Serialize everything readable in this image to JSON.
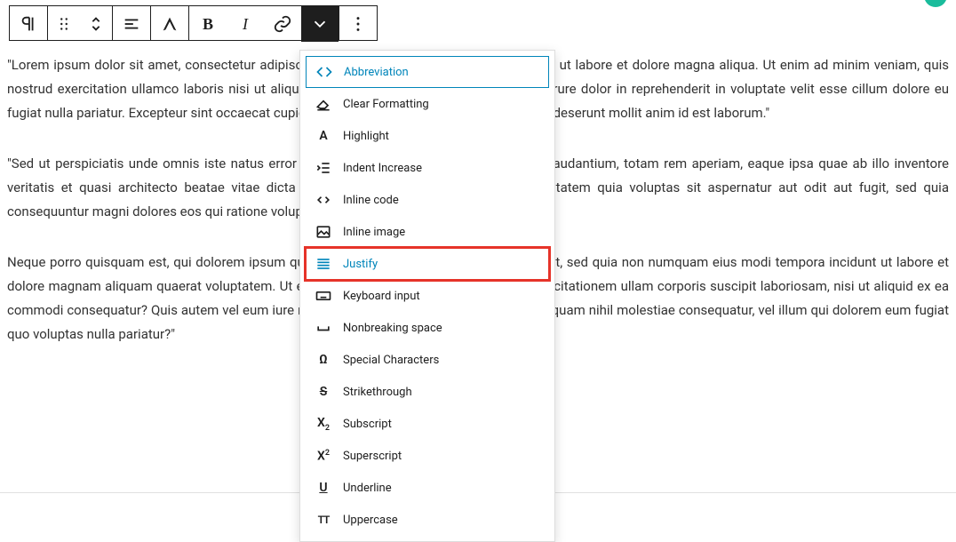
{
  "toolbar": {
    "bold_label": "B",
    "italic_label": "I"
  },
  "paragraphs": [
    "\"Lorem ipsum dolor sit amet, consectetur adipiscing elit, sed do eiusmod tempor incididunt ut labore et dolore magna aliqua. Ut enim ad minim veniam, quis nostrud exercitation ullamco laboris nisi ut aliquip ex ea commodo consequat. Duis aute irure dolor in reprehenderit in voluptate velit esse cillum dolore eu fugiat nulla pariatur. Excepteur sint occaecat cupidatat non proident, sunt in culpa qui officia deserunt mollit anim id est laborum.\"",
    "\"Sed ut perspiciatis unde omnis iste natus error sit voluptatem accusantium doloremque laudantium, totam rem aperiam, eaque ipsa quae ab illo inventore veritatis et quasi architecto beatae vitae dicta sunt explicabo. Nemo enim ipsam voluptatem quia voluptas sit aspernatur aut odit aut fugit, sed quia consequuntur magni dolores eos qui ratione voluptatem sequi nesciunt.",
    "Neque porro quisquam est, qui dolorem ipsum quia dolor sit amet, consectetur, adipisci velit, sed quia non numquam eius modi tempora incidunt ut labore et dolore magnam aliquam quaerat voluptatem. Ut enim ad minima veniam, quis nostrum exercitationem ullam corporis suscipit laboriosam, nisi ut aliquid ex ea commodi consequatur? Quis autem vel eum iure reprehenderit qui in ea voluptate velit esse quam nihil molestiae consequatur, vel illum qui dolorem eum fugiat quo voluptas nulla pariatur?\""
  ],
  "dropdown": {
    "items": [
      {
        "label": "Abbreviation",
        "icon": "angle-brackets",
        "active": true
      },
      {
        "label": "Clear Formatting",
        "icon": "eraser"
      },
      {
        "label": "Highlight",
        "icon": "letter-a"
      },
      {
        "label": "Indent Increase",
        "icon": "indent"
      },
      {
        "label": "Inline code",
        "icon": "angle-brackets"
      },
      {
        "label": "Inline image",
        "icon": "image"
      },
      {
        "label": "Justify",
        "icon": "justify",
        "highlighted": true
      },
      {
        "label": "Keyboard input",
        "icon": "keyboard"
      },
      {
        "label": "Nonbreaking space",
        "icon": "nbsp"
      },
      {
        "label": "Special Characters",
        "icon": "omega"
      },
      {
        "label": "Strikethrough",
        "icon": "strike"
      },
      {
        "label": "Subscript",
        "icon": "subscript"
      },
      {
        "label": "Superscript",
        "icon": "superscript"
      },
      {
        "label": "Underline",
        "icon": "underline"
      },
      {
        "label": "Uppercase",
        "icon": "uppercase"
      }
    ]
  }
}
